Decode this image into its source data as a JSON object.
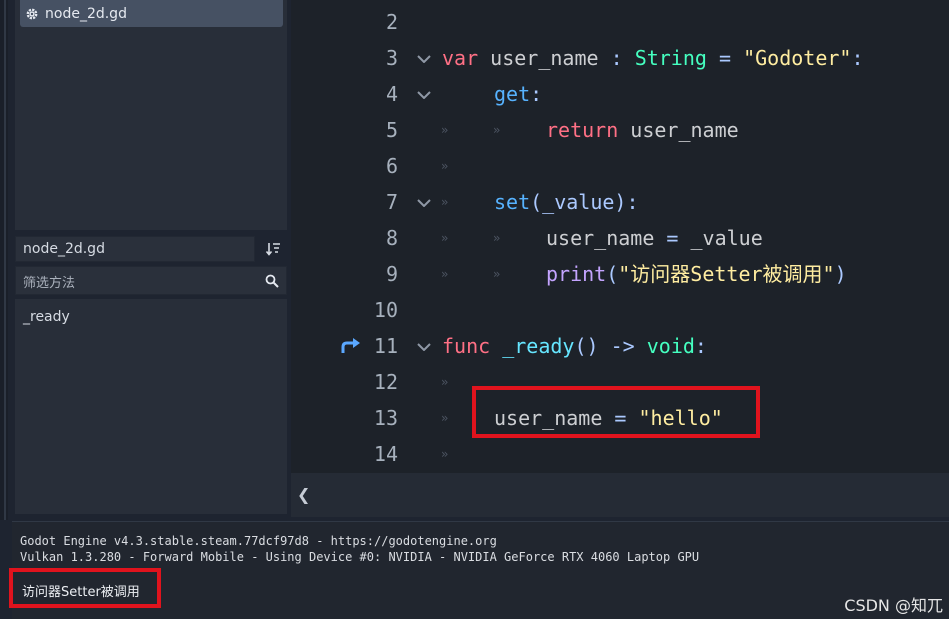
{
  "sidebar": {
    "script_item": "node_2d.gd",
    "file_field": "node_2d.gd",
    "filter_placeholder": "筛选方法",
    "methods": [
      "_ready"
    ]
  },
  "editor": {
    "lines": [
      {
        "num": "2"
      },
      {
        "num": "3"
      },
      {
        "num": "4"
      },
      {
        "num": "5"
      },
      {
        "num": "6"
      },
      {
        "num": "7"
      },
      {
        "num": "8"
      },
      {
        "num": "9"
      },
      {
        "num": "10"
      },
      {
        "num": "11"
      },
      {
        "num": "12"
      },
      {
        "num": "13"
      },
      {
        "num": "14"
      }
    ],
    "code": {
      "l3_var": "var",
      "l3_name": "user_name",
      "l3_colon": ":",
      "l3_type": "String",
      "l3_eq": "=",
      "l3_str": "\"Godoter\"",
      "l3_end": ":",
      "l4_get": "get",
      "l4_colon": ":",
      "l5_return": "return",
      "l5_name": "user_name",
      "l7_set": "set",
      "l7_args": "(_value):",
      "l8_name": "user_name",
      "l8_eq": "=",
      "l8_val": "_value",
      "l9_print": "print",
      "l9_open": "(",
      "l9_str": "\"访问器Setter被调用\"",
      "l9_close": ")",
      "l11_func": "func",
      "l11_name": "_ready",
      "l11_parens": "()",
      "l11_arrow": "->",
      "l11_void": "void",
      "l11_colon": ":",
      "l13_name": "user_name",
      "l13_eq": "=",
      "l13_str": "\"hello\""
    }
  },
  "output": {
    "line1": "Godot Engine v4.3.stable.steam.77dcf97d8 - https://godotengine.org",
    "line2": "Vulkan 1.3.280 - Forward Mobile - Using Device #0: NVIDIA - NVIDIA GeForce RTX 4060 Laptop GPU",
    "printed": "访问器Setter被调用"
  },
  "watermark": "CSDN @知兀",
  "colors": {
    "highlight_box": "#e0131d",
    "keyword": "#ff7085",
    "type": "#45ffc0",
    "string": "#ffeda1"
  }
}
